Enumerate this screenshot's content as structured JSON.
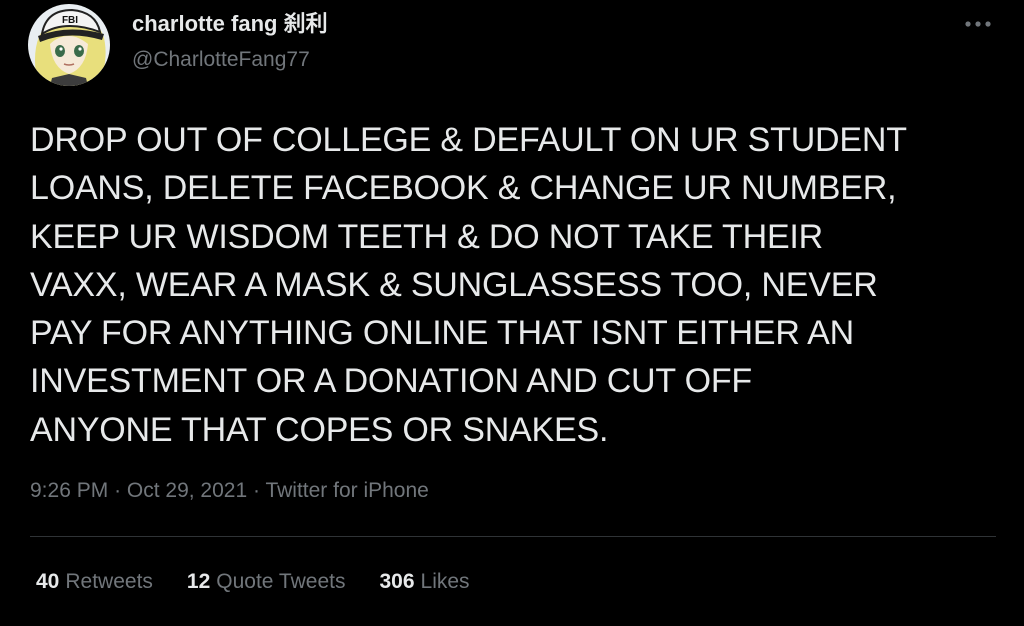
{
  "author": {
    "display_name": "charlotte fang 刹利",
    "handle": "@CharlotteFang77",
    "avatar_badge": "FBI"
  },
  "tweet": {
    "text": "DROP OUT OF COLLEGE & DEFAULT ON UR STUDENT\nLOANS, DELETE FACEBOOK & CHANGE UR NUMBER,\nKEEP UR WISDOM TEETH & DO NOT TAKE THEIR\nVAXX, WEAR A MASK & SUNGLASSESS TOO, NEVER\nPAY FOR ANYTHING ONLINE THAT ISNT EITHER AN\nINVESTMENT OR A DONATION AND CUT OFF\nANYONE THAT COPES OR SNAKES."
  },
  "meta": {
    "time": "9:26 PM",
    "separator": "·",
    "date": "Oct 29, 2021",
    "source": "Twitter for iPhone"
  },
  "stats": {
    "retweets": {
      "count": "40",
      "label": "Retweets"
    },
    "quote_tweets": {
      "count": "12",
      "label": "Quote Tweets"
    },
    "likes": {
      "count": "306",
      "label": "Likes"
    }
  },
  "colors": {
    "background": "#000000",
    "text_primary": "#e7e9ea",
    "text_secondary": "#71767b",
    "divider": "#2f3336"
  },
  "icons": {
    "more": "more-horizontal-icon"
  }
}
